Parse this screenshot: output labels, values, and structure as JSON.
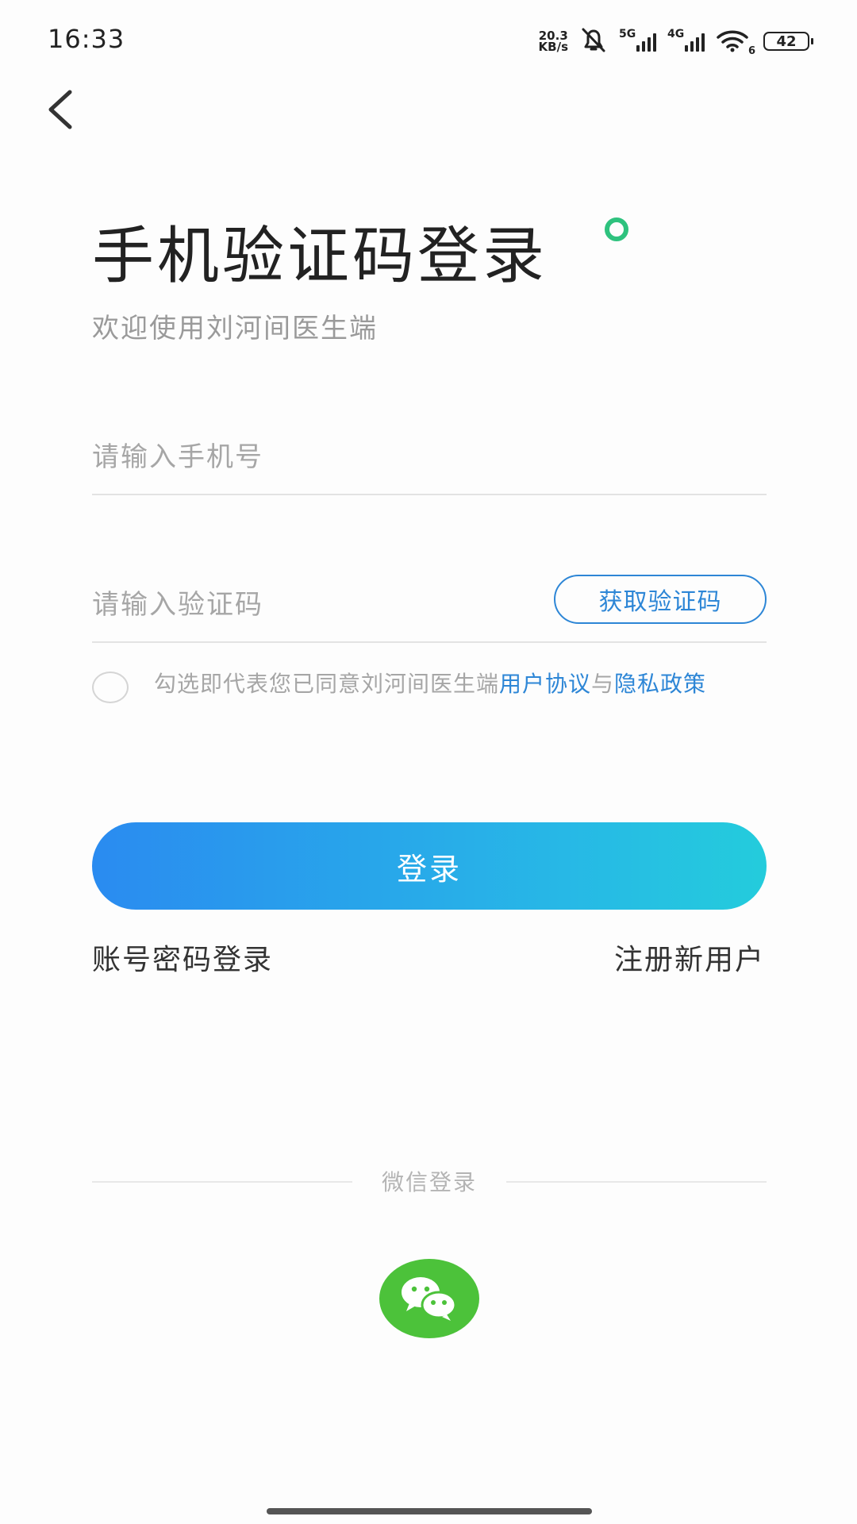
{
  "status_bar": {
    "time": "16:33",
    "net_speed_value": "20.3",
    "net_speed_unit": "KB/s",
    "signal_1_label": "5G",
    "signal_2_label": "4G",
    "wifi_label": "6",
    "battery": "42"
  },
  "header": {
    "title": "手机验证码登录",
    "subtitle": "欢迎使用刘河间医生端"
  },
  "form": {
    "phone_placeholder": "请输入手机号",
    "phone_value": "",
    "code_placeholder": "请输入验证码",
    "code_value": "",
    "get_code_label": "获取验证码",
    "agreement_prefix": "勾选即代表您已同意刘河间医生端",
    "user_agreement": "用户协议",
    "agreement_and": "与",
    "privacy_policy": "隐私政策",
    "agreement_checked": false
  },
  "actions": {
    "login_label": "登录",
    "password_login_label": "账号密码登录",
    "register_label": "注册新用户"
  },
  "wechat": {
    "divider_label": "微信登录"
  },
  "colors": {
    "accent_blue": "#2d86d6",
    "button_gradient_start": "#2a8bf0",
    "button_gradient_end": "#24ccdc",
    "wechat_green": "#4cc23a",
    "title_dot": "#2ec27e"
  },
  "icons": [
    "back-icon",
    "mute-bell-icon",
    "wifi-icon",
    "battery-icon",
    "wechat-icon"
  ]
}
